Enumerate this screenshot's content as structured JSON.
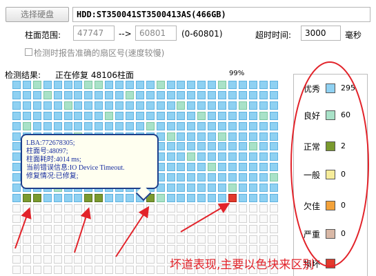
{
  "toolbar": {
    "select_disk_label": "选择硬盘",
    "disk_info": "HDD:ST350041ST3500413AS(466GB)"
  },
  "range": {
    "label": "柱面范围:",
    "from_value": "47747",
    "arrow": "-->",
    "to_value": "60801",
    "hint": "(0-60801)",
    "timeout_label": "超时时间:",
    "timeout_value": "3000",
    "timeout_unit": "毫秒"
  },
  "options": {
    "report_checkbox_label": "检测时报告准确的扇区号(速度较慢)",
    "report_checked": false
  },
  "status": {
    "label": "检测结果:",
    "text": "正在修复 48106柱面",
    "progress_text": "99%",
    "progress": 0.99
  },
  "legend": {
    "items": [
      {
        "label": "优秀",
        "count": "295",
        "color": "#8fd1f2"
      },
      {
        "label": "良好",
        "count": "60",
        "color": "#a9e2c8"
      },
      {
        "label": "正常",
        "count": "2",
        "color": "#7a9a2e"
      },
      {
        "label": "一般",
        "count": "0",
        "color": "#f6ec9a"
      },
      {
        "label": "欠佳",
        "count": "0",
        "color": "#f3a23a"
      },
      {
        "label": "严重",
        "count": "0",
        "color": "#d9b8a6"
      },
      {
        "label": "损坏",
        "count": "",
        "color": "#e23a2c"
      }
    ]
  },
  "tooltip": {
    "lines": [
      "LBA:772678305;",
      "柱面号:48097;",
      "柱面耗时:4014 ms;",
      "当前错误信息:IO Device Timeout.",
      "修复情况:已修复;"
    ]
  },
  "annotation": {
    "caption": "坏道表现,主要以色块来区别"
  },
  "grid": {
    "columns": 26,
    "rows": 19,
    "good_cells": [
      [
        0,
        2
      ],
      [
        0,
        7
      ],
      [
        0,
        8
      ],
      [
        0,
        14
      ],
      [
        0,
        20
      ],
      [
        1,
        3
      ],
      [
        1,
        11
      ],
      [
        2,
        5
      ],
      [
        2,
        16
      ],
      [
        2,
        22
      ],
      [
        3,
        9
      ],
      [
        3,
        18
      ],
      [
        3,
        24
      ],
      [
        4,
        1
      ],
      [
        4,
        13
      ],
      [
        5,
        6
      ],
      [
        5,
        15
      ],
      [
        5,
        20
      ],
      [
        6,
        10
      ],
      [
        6,
        23
      ],
      [
        7,
        2
      ],
      [
        7,
        17
      ],
      [
        8,
        7
      ],
      [
        8,
        19
      ],
      [
        9,
        12
      ],
      [
        9,
        25
      ],
      [
        10,
        4
      ],
      [
        10,
        21
      ],
      [
        11,
        8
      ],
      [
        11,
        14
      ]
    ],
    "normal_cells": [
      [
        11,
        1
      ],
      [
        11,
        2
      ],
      [
        11,
        7
      ],
      [
        11,
        8
      ],
      [
        11,
        13
      ]
    ],
    "bad_cells": [
      [
        11,
        21
      ]
    ],
    "filled_rows": 11,
    "filled_last_row_cols": 26
  }
}
